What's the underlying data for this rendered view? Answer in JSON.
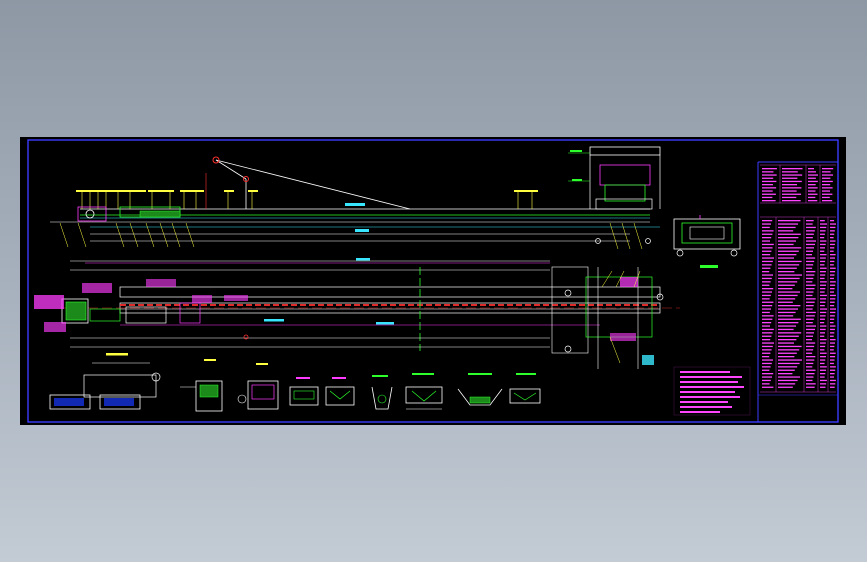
{
  "canvas": {
    "background": "#9aa4b1",
    "sheet_background": "#000000"
  },
  "colors": {
    "frame": "#3b3bff",
    "line_white": "#ffffff",
    "line_green": "#2cff2c",
    "line_cyan": "#39e6ff",
    "line_yellow": "#ffff40",
    "line_magenta": "#ff3cff",
    "line_red": "#ff3030",
    "table_text": "#ff44ff",
    "note_text": "#ff44ff"
  },
  "drawing": {
    "views": [
      "elevation-view",
      "plan-view",
      "head-end-section",
      "tail-end-section",
      "detail-sections",
      "notes-block",
      "parts-table"
    ]
  }
}
